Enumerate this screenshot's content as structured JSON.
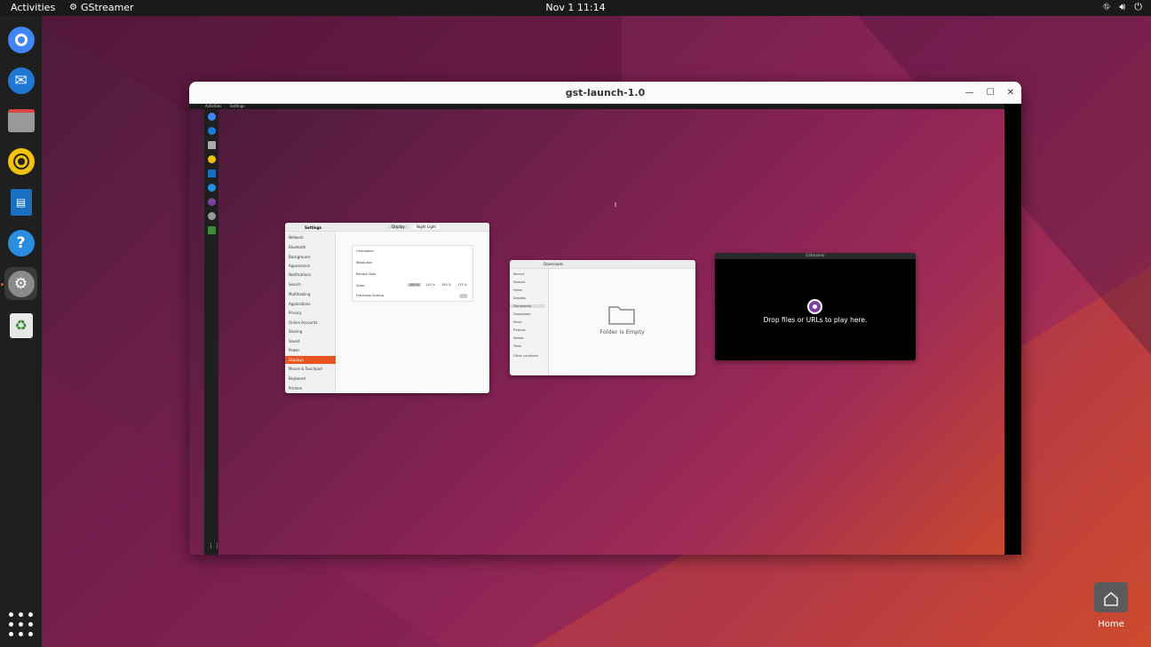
{
  "topbar": {
    "activities": "Activities",
    "app_name": "GStreamer",
    "clock": "Nov 1  11:14",
    "tray_icons": [
      "network-icon",
      "volume-icon",
      "power-icon"
    ]
  },
  "dock": {
    "items": [
      {
        "name": "chromium",
        "icon": "browser-icon",
        "color": "#4285f4"
      },
      {
        "name": "thunderbird",
        "icon": "mail-icon",
        "color": "#1f79d4"
      },
      {
        "name": "files",
        "icon": "folder-icon",
        "color": "#9a9a9a"
      },
      {
        "name": "rhythmbox",
        "icon": "music-icon",
        "color": "#f4c20d"
      },
      {
        "name": "writer",
        "icon": "document-icon",
        "color": "#1a6fbf"
      },
      {
        "name": "help",
        "icon": "help-icon",
        "color": "#2a8de0"
      },
      {
        "name": "settings",
        "icon": "gear-icon",
        "color": "#8a8a8a",
        "active": true
      },
      {
        "name": "trash",
        "icon": "trash-icon",
        "color": "#3d8a3d"
      }
    ],
    "show_apps_icon": "grid-icon"
  },
  "window": {
    "title": "gst-launch-1.0",
    "controls": [
      "minimize",
      "maximize",
      "close"
    ]
  },
  "inner": {
    "topbar_activities": "Activities",
    "topbar_app": "Settings",
    "settings_window": {
      "title": "Settings",
      "tabs": [
        "Display",
        "Night Light"
      ],
      "sidebar": [
        "Network",
        "Bluetooth",
        "Background",
        "Appearance",
        "Notifications",
        "Search",
        "Multitasking",
        "Applications",
        "Privacy",
        "Online Accounts",
        "Sharing",
        "Sound",
        "Power",
        "Displays",
        "Mouse & Touchpad",
        "Keyboard",
        "Printers"
      ],
      "selected": "Displays",
      "panel_rows": [
        "Orientation",
        "Resolution",
        "Refresh Rate",
        "Scale",
        "Fractional Scaling"
      ],
      "scale_options": [
        "100 %",
        "125 %",
        "150 %",
        "175 %"
      ]
    },
    "files_window": {
      "path": "Downloads",
      "sidebar": [
        "Recent",
        "Starred",
        "Home",
        "Desktop",
        "Documents",
        "Downloads",
        "Music",
        "Pictures",
        "Videos",
        "Trash",
        "Other Locations"
      ],
      "empty_text": "Folder is Empty"
    },
    "player_window": {
      "title": "GStreamer",
      "message": "Drop files or URLs to play here."
    }
  },
  "desktop": {
    "home_label": "Home"
  }
}
